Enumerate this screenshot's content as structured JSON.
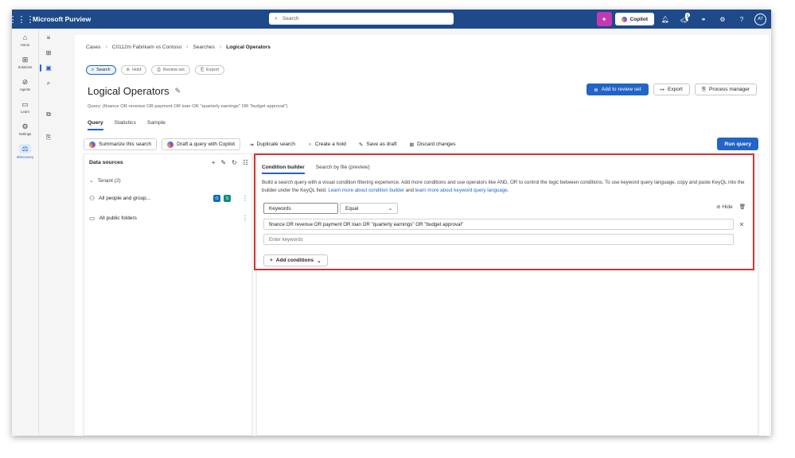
{
  "app": {
    "title": "Microsoft Purview",
    "search_placeholder": "Search",
    "copilot_label": "Copilot",
    "notification_count": "1",
    "avatar_initials": "AT"
  },
  "rail": {
    "items": [
      {
        "label": "Home",
        "icon": "home-icon"
      },
      {
        "label": "Solutions",
        "icon": "grid-icon"
      },
      {
        "label": "Agents",
        "icon": "agents-icon"
      },
      {
        "label": "Learn",
        "icon": "book-icon"
      },
      {
        "label": "Settings",
        "icon": "gear-icon"
      },
      {
        "label": "eDiscovery",
        "icon": "ediscovery-icon"
      }
    ]
  },
  "breadcrumb": {
    "items": [
      "Cases",
      "C0112m Fabrikam vs Contoso",
      "Searches",
      "Logical Operators"
    ]
  },
  "pills": {
    "search": "Search",
    "hold": "Hold",
    "review_set": "Review set",
    "export": "Export"
  },
  "page": {
    "title": "Logical Operators",
    "query_text": "Query: (finance OR revenue OR payment OR loan OR \"quarterly earnings\" OR \"budget approval\")",
    "add_to_review_set": "Add to review set",
    "export": "Export",
    "process_manager": "Process manager"
  },
  "tabs": [
    "Query",
    "Statistics",
    "Sample"
  ],
  "toolbar": {
    "summarize": "Summarize this search",
    "draft_copilot": "Draft a query with Copilot",
    "duplicate": "Duplicate search",
    "create_hold": "Create a hold",
    "save_draft": "Save as draft",
    "discard": "Discard changes",
    "run_query": "Run query"
  },
  "data_sources": {
    "heading": "Data sources",
    "tenant": "Tenant (2)",
    "items": [
      {
        "label": "All people and group..."
      },
      {
        "label": "All public folders"
      }
    ]
  },
  "condition_builder": {
    "tab_builder": "Condition builder",
    "tab_file": "Search by file (preview)",
    "description": "Build a search query with a visual condition filtering experience. Add more conditions and use operators like AND, OR to control the logic between conditions. To use keyword query language, copy and paste KeyQL into the builder under the KeyQL field.",
    "link1": "Learn more about condition builder",
    "and_text": "and",
    "link2": "learn more about keyword query language.",
    "field_name": "Keywords",
    "operator": "Equal",
    "hide_label": "Hide",
    "keyword_value": "finance OR revenue OR payment OR loan OR \"quarterly earnings\" OR \"budget approval\"",
    "keyword_placeholder": "Enter keywords",
    "add_conditions": "Add conditions"
  }
}
